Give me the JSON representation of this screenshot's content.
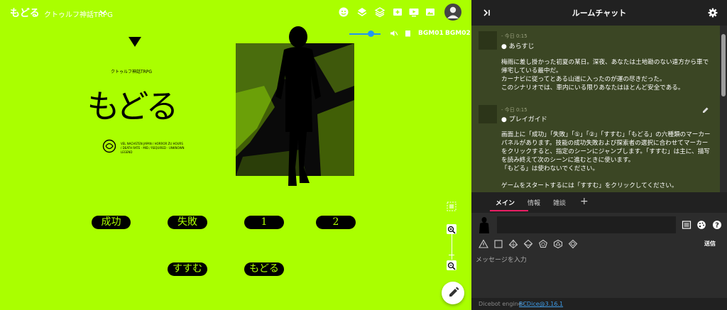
{
  "room": {
    "name": "もどる",
    "subtitle": "クトゥルフ神話TRPG"
  },
  "toolbar": {
    "icons": [
      "smile-icon",
      "layers-icon",
      "stack-icon",
      "add-image-icon",
      "play-screen-icon",
      "gallery-icon",
      "account-icon"
    ]
  },
  "bgm": {
    "bgm1_label": "BGM01",
    "bgm2_label": "BGM02",
    "volume": 0.6
  },
  "scene": {
    "subtitle": "クトゥルフ神話TRPG",
    "title": "もどる",
    "credits": "VEL NACHSTEN JAPAN / HORROR ZU HOURS / DEATH RATE - MID / REQUIRED - UNKNOWN LEGEND"
  },
  "markers": [
    {
      "label": "成功"
    },
    {
      "label": "失敗"
    },
    {
      "label": "1"
    },
    {
      "label": "2"
    },
    {
      "label": "すすむ"
    },
    {
      "label": "もどる"
    }
  ],
  "chat": {
    "title": "ルームチャット",
    "messages": [
      {
        "time": "- 今日 0:15",
        "heading": "● あらすじ",
        "lines": [
          "梅雨に差し掛かった初夏の某日。深夜、あなたは土地勘のない遠方から車で",
          "帰宅している最中だ。",
          "カーナビに従ってとある山道に入ったのが運の尽きだった。",
          "このシナリオでは、車内にいる限りあなたはほとんど安全である。"
        ]
      },
      {
        "time": "- 今日 0:15",
        "heading": "● プレイガイド",
        "lines": [
          "画面上に「成功」「失敗」「①」「②」「すすむ」「もどる」の六種類のマーカー",
          "パネルがあります。技能の成功失敗および探索者の選択に合わせてマーカー",
          "をクリックすると、指定のシーンにジャンプします。「すすむ」は主に、描写",
          "を読み終えて次のシーンに進むときに使います。",
          "「もどる」は使わないでください。",
          "",
          "ゲームをスタートするには「すすむ」をクリックしてください。"
        ]
      }
    ],
    "tabs": [
      {
        "label": "メイン",
        "active": true
      },
      {
        "label": "情報",
        "active": false
      },
      {
        "label": "雑談",
        "active": false
      }
    ],
    "add_tab_label": "+",
    "send_label": "送信",
    "input_placeholder": "メッセージを入力",
    "dicebot_label": "Dicebot engine :",
    "dicebot_link": "BCDice@3.16.1"
  },
  "colors": {
    "board_bg": "#aaff00",
    "log_bg": "#3b4624",
    "accent": "#e91e63",
    "link": "#3f9be6"
  }
}
